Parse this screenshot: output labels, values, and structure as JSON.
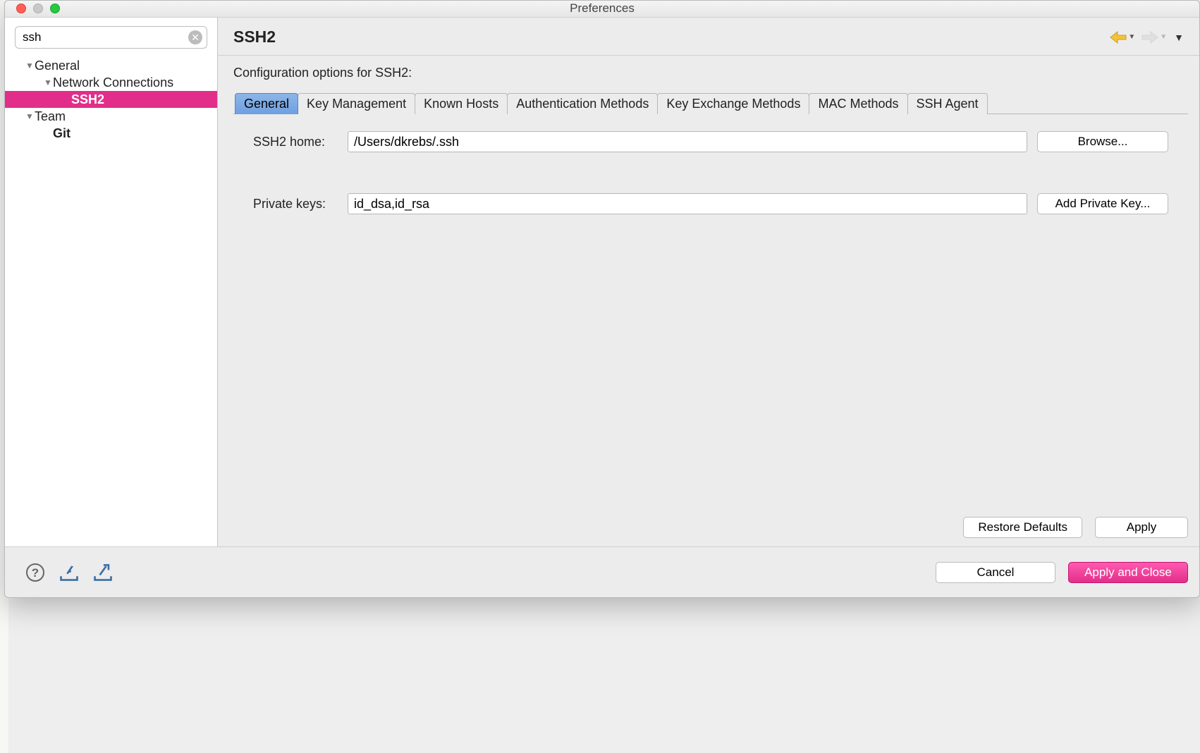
{
  "window": {
    "title": "Preferences"
  },
  "search": {
    "value": "ssh"
  },
  "tree": {
    "nodes": [
      {
        "label": "General",
        "level": 0,
        "expanded": true
      },
      {
        "label": "Network Connections",
        "level": 1,
        "expanded": true
      },
      {
        "label": "SSH2",
        "level": 2,
        "selected": true
      },
      {
        "label": "Team",
        "level": 0,
        "expanded": true
      },
      {
        "label": "Git",
        "level": 1,
        "bold": true
      }
    ]
  },
  "page": {
    "title": "SSH2",
    "description": "Configuration options for SSH2:"
  },
  "tabs": [
    {
      "label": "General",
      "active": true
    },
    {
      "label": "Key Management"
    },
    {
      "label": "Known Hosts"
    },
    {
      "label": "Authentication Methods"
    },
    {
      "label": "Key Exchange Methods"
    },
    {
      "label": "MAC Methods"
    },
    {
      "label": "SSH Agent"
    }
  ],
  "form": {
    "ssh2_home_label": "SSH2 home:",
    "ssh2_home_value": "/Users/dkrebs/.ssh",
    "browse_label": "Browse...",
    "private_keys_label": "Private keys:",
    "private_keys_value": "id_dsa,id_rsa",
    "add_key_label": "Add Private Key..."
  },
  "buttons": {
    "restore_defaults": "Restore Defaults",
    "apply": "Apply",
    "cancel": "Cancel",
    "apply_and_close": "Apply and Close"
  }
}
